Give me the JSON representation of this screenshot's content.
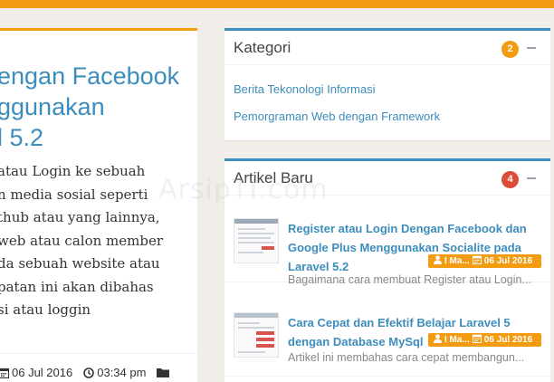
{
  "post": {
    "title": "engan Facebook\nggunakan\nl 5.2",
    "excerpt": " atau Login ke sebuah\nn media sosial seperti\nthub atau yang lainnya,\n web atau calon member\nda sebuah website atau\npatan ini akan dibahas\nsi atau loggin",
    "date": "06 Jul 2016",
    "time": "03:34 pm",
    "icons": [
      "calendar-icon",
      "clock-icon",
      "folder-icon"
    ]
  },
  "kategori": {
    "title": "Kategori",
    "count": "2",
    "items": [
      "Berita Tekonologi Informasi",
      "Pemorgraman Web dengan Framework"
    ]
  },
  "artikel": {
    "title": "Artikel Baru",
    "count": "4",
    "items": [
      {
        "title": "Register atau Login Dengan Facebook dan\nGoogle Plus Menggunakan Socialite pada\nLaravel 5.2",
        "author": "I Ma...",
        "date": "06 Jul 2016",
        "description": "Bagaimana cara membuat Register atau Login..."
      },
      {
        "title": "Cara Cepat dan Efektif Belajar Laravel 5\ndengan Database MySql",
        "author": "I Ma...",
        "date": "06 Jul 2016",
        "description": "Artikel ini membahas cara cepat membangun..."
      }
    ]
  },
  "watermark": "ArsipTI.com",
  "colors": {
    "accent": "#f39c12",
    "primary": "#3c8dbc",
    "danger": "#dd4b39"
  }
}
